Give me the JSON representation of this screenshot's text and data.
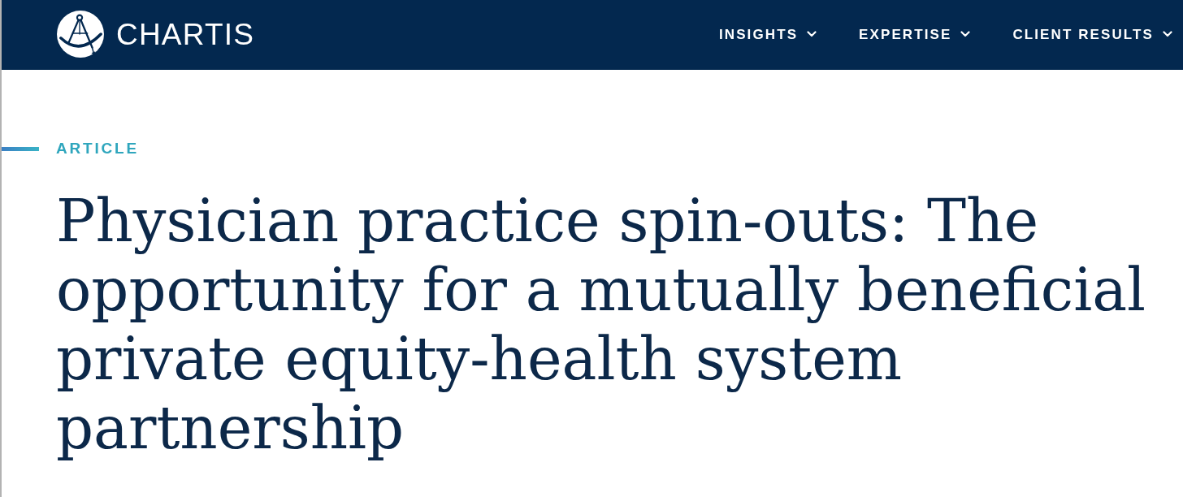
{
  "header": {
    "logo": {
      "wordmark": "CHARTIS"
    },
    "nav": [
      {
        "label": "INSIGHTS"
      },
      {
        "label": "EXPERTISE"
      },
      {
        "label": "CLIENT RESULTS"
      }
    ]
  },
  "article": {
    "category": "ARTICLE",
    "title": "Physician practice spin-outs: The opportunity for a mutually beneficial private equity-health system partnership"
  }
}
